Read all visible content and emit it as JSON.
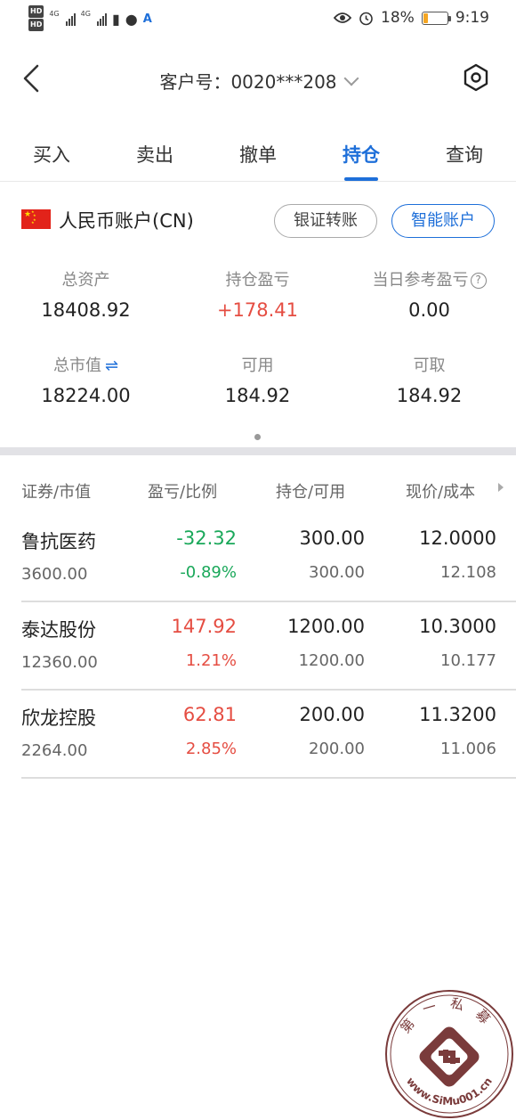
{
  "status_bar": {
    "battery": "18%",
    "battery_level": 0.18,
    "time": "9:19",
    "network_1": "4G",
    "network_2": "4G"
  },
  "header": {
    "client_label": "客户号：0020***208"
  },
  "tabs": [
    {
      "label": "买入",
      "active": false
    },
    {
      "label": "卖出",
      "active": false
    },
    {
      "label": "撤单",
      "active": false
    },
    {
      "label": "持仓",
      "active": true
    },
    {
      "label": "查询",
      "active": false
    }
  ],
  "account": {
    "name": "人民币账户(CN)",
    "transfer_label": "银证转账",
    "smart_label": "智能账户"
  },
  "summary": {
    "total_assets_label": "总资产",
    "total_assets": "18408.92",
    "position_pl_label": "持仓盈亏",
    "position_pl": "+178.41",
    "today_pl_label": "当日参考盈亏",
    "today_pl": "0.00",
    "market_value_label": "总市值",
    "market_value": "18224.00",
    "available_label": "可用",
    "available": "184.92",
    "withdrawable_label": "可取",
    "withdrawable": "184.92"
  },
  "table": {
    "headers": [
      "证券/市值",
      "盈亏/比例",
      "持仓/可用",
      "现价/成本"
    ],
    "rows": [
      {
        "name": "鲁抗医药",
        "market_value": "3600.00",
        "pl": "-32.32",
        "ratio": "-0.89%",
        "position": "300.00",
        "available": "300.00",
        "price": "12.0000",
        "cost": "12.108",
        "trend": "down"
      },
      {
        "name": "泰达股份",
        "market_value": "12360.00",
        "pl": "147.92",
        "ratio": "1.21%",
        "position": "1200.00",
        "available": "1200.00",
        "price": "10.3000",
        "cost": "10.177",
        "trend": "up"
      },
      {
        "name": "欣龙控股",
        "market_value": "2264.00",
        "pl": "62.81",
        "ratio": "2.85%",
        "position": "200.00",
        "available": "200.00",
        "price": "11.3200",
        "cost": "11.006",
        "trend": "up"
      }
    ]
  },
  "watermark": {
    "top_text": "第一私募",
    "bottom_text": "www.SiMu001.cn"
  },
  "colors": {
    "accent": "#1e6fd9",
    "up": "#e54d42",
    "down": "#1aa85a"
  }
}
